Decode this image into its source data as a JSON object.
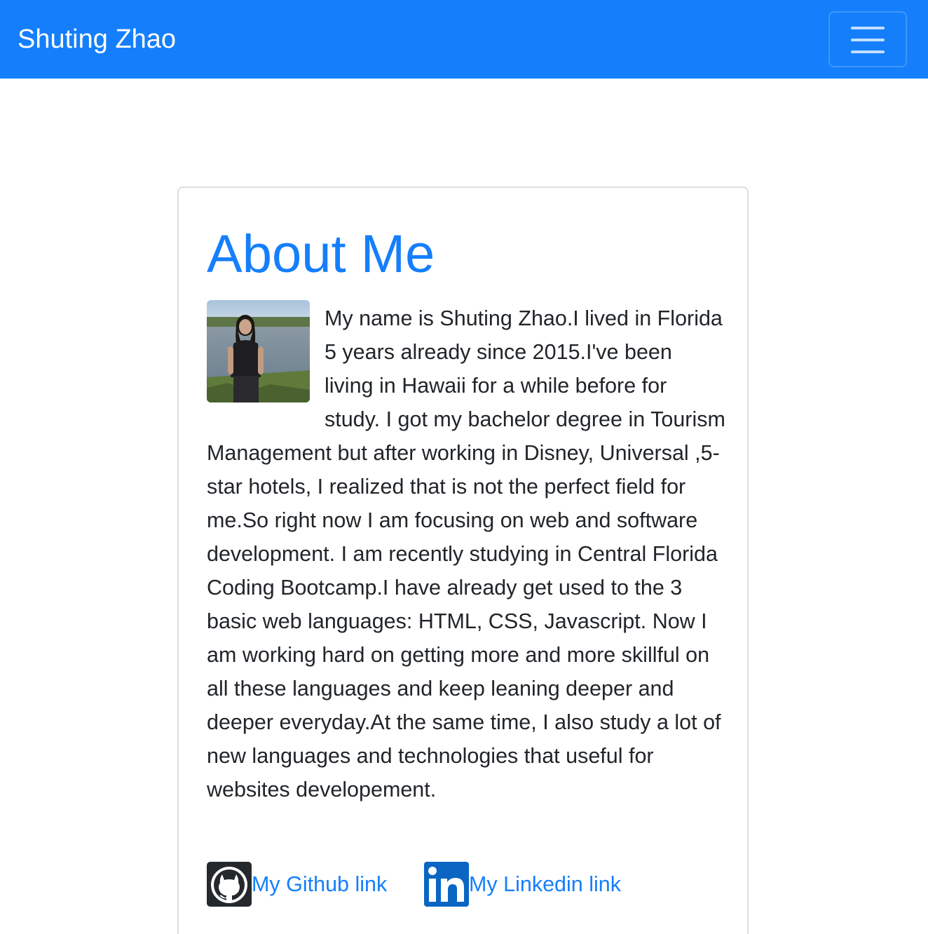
{
  "navbar": {
    "brand": "Shuting Zhao",
    "brand_color": "#157ffb",
    "toggle_icon": "hamburger-menu-icon"
  },
  "about": {
    "heading": "About Me",
    "photo": "profile-photo",
    "bio": "My name is Shuting Zhao.I lived in Florida 5 years already since 2015.I've been living in Hawaii for a while before for study. I got my bachelor degree in Tourism Management but after working in Disney, Universal ,5-star hotels, I realized that is not the perfect field for me.So right now I am focusing on web and software development. I am recently studying in Central Florida Coding Bootcamp.I have already get used to the 3 basic web languages: HTML, CSS, Javascript. Now I am working hard on getting more and more skillful on all these languages and keep leaning deeper and deeper everyday.At the same time, I also study a lot of new languages and technologies that useful for websites developement."
  },
  "links": {
    "github": {
      "label": "My Github link",
      "icon": "github-icon"
    },
    "linkedin": {
      "label": "My Linkedin link",
      "icon": "linkedin-icon"
    }
  }
}
